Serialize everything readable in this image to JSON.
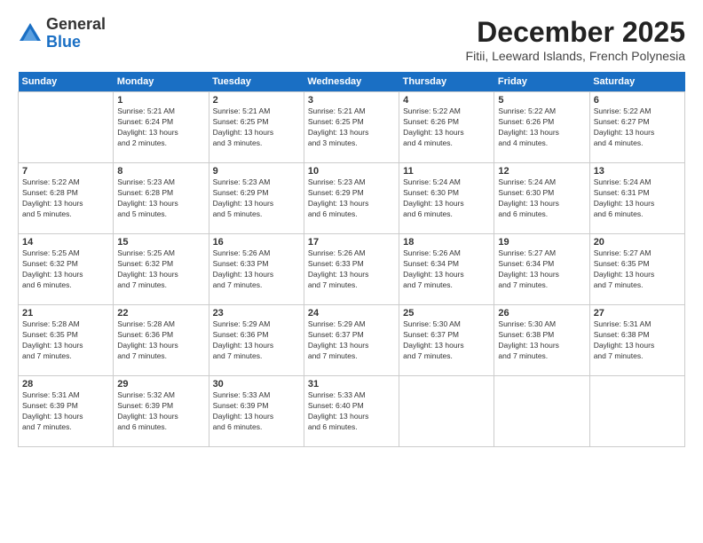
{
  "logo": {
    "general": "General",
    "blue": "Blue"
  },
  "title": "December 2025",
  "location": "Fitii, Leeward Islands, French Polynesia",
  "days_header": [
    "Sunday",
    "Monday",
    "Tuesday",
    "Wednesday",
    "Thursday",
    "Friday",
    "Saturday"
  ],
  "weeks": [
    [
      {
        "day": "",
        "text": ""
      },
      {
        "day": "1",
        "text": "Sunrise: 5:21 AM\nSunset: 6:24 PM\nDaylight: 13 hours\nand 2 minutes."
      },
      {
        "day": "2",
        "text": "Sunrise: 5:21 AM\nSunset: 6:25 PM\nDaylight: 13 hours\nand 3 minutes."
      },
      {
        "day": "3",
        "text": "Sunrise: 5:21 AM\nSunset: 6:25 PM\nDaylight: 13 hours\nand 3 minutes."
      },
      {
        "day": "4",
        "text": "Sunrise: 5:22 AM\nSunset: 6:26 PM\nDaylight: 13 hours\nand 4 minutes."
      },
      {
        "day": "5",
        "text": "Sunrise: 5:22 AM\nSunset: 6:26 PM\nDaylight: 13 hours\nand 4 minutes."
      },
      {
        "day": "6",
        "text": "Sunrise: 5:22 AM\nSunset: 6:27 PM\nDaylight: 13 hours\nand 4 minutes."
      }
    ],
    [
      {
        "day": "7",
        "text": "Sunrise: 5:22 AM\nSunset: 6:28 PM\nDaylight: 13 hours\nand 5 minutes."
      },
      {
        "day": "8",
        "text": "Sunrise: 5:23 AM\nSunset: 6:28 PM\nDaylight: 13 hours\nand 5 minutes."
      },
      {
        "day": "9",
        "text": "Sunrise: 5:23 AM\nSunset: 6:29 PM\nDaylight: 13 hours\nand 5 minutes."
      },
      {
        "day": "10",
        "text": "Sunrise: 5:23 AM\nSunset: 6:29 PM\nDaylight: 13 hours\nand 6 minutes."
      },
      {
        "day": "11",
        "text": "Sunrise: 5:24 AM\nSunset: 6:30 PM\nDaylight: 13 hours\nand 6 minutes."
      },
      {
        "day": "12",
        "text": "Sunrise: 5:24 AM\nSunset: 6:30 PM\nDaylight: 13 hours\nand 6 minutes."
      },
      {
        "day": "13",
        "text": "Sunrise: 5:24 AM\nSunset: 6:31 PM\nDaylight: 13 hours\nand 6 minutes."
      }
    ],
    [
      {
        "day": "14",
        "text": "Sunrise: 5:25 AM\nSunset: 6:32 PM\nDaylight: 13 hours\nand 6 minutes."
      },
      {
        "day": "15",
        "text": "Sunrise: 5:25 AM\nSunset: 6:32 PM\nDaylight: 13 hours\nand 7 minutes."
      },
      {
        "day": "16",
        "text": "Sunrise: 5:26 AM\nSunset: 6:33 PM\nDaylight: 13 hours\nand 7 minutes."
      },
      {
        "day": "17",
        "text": "Sunrise: 5:26 AM\nSunset: 6:33 PM\nDaylight: 13 hours\nand 7 minutes."
      },
      {
        "day": "18",
        "text": "Sunrise: 5:26 AM\nSunset: 6:34 PM\nDaylight: 13 hours\nand 7 minutes."
      },
      {
        "day": "19",
        "text": "Sunrise: 5:27 AM\nSunset: 6:34 PM\nDaylight: 13 hours\nand 7 minutes."
      },
      {
        "day": "20",
        "text": "Sunrise: 5:27 AM\nSunset: 6:35 PM\nDaylight: 13 hours\nand 7 minutes."
      }
    ],
    [
      {
        "day": "21",
        "text": "Sunrise: 5:28 AM\nSunset: 6:35 PM\nDaylight: 13 hours\nand 7 minutes."
      },
      {
        "day": "22",
        "text": "Sunrise: 5:28 AM\nSunset: 6:36 PM\nDaylight: 13 hours\nand 7 minutes."
      },
      {
        "day": "23",
        "text": "Sunrise: 5:29 AM\nSunset: 6:36 PM\nDaylight: 13 hours\nand 7 minutes."
      },
      {
        "day": "24",
        "text": "Sunrise: 5:29 AM\nSunset: 6:37 PM\nDaylight: 13 hours\nand 7 minutes."
      },
      {
        "day": "25",
        "text": "Sunrise: 5:30 AM\nSunset: 6:37 PM\nDaylight: 13 hours\nand 7 minutes."
      },
      {
        "day": "26",
        "text": "Sunrise: 5:30 AM\nSunset: 6:38 PM\nDaylight: 13 hours\nand 7 minutes."
      },
      {
        "day": "27",
        "text": "Sunrise: 5:31 AM\nSunset: 6:38 PM\nDaylight: 13 hours\nand 7 minutes."
      }
    ],
    [
      {
        "day": "28",
        "text": "Sunrise: 5:31 AM\nSunset: 6:39 PM\nDaylight: 13 hours\nand 7 minutes."
      },
      {
        "day": "29",
        "text": "Sunrise: 5:32 AM\nSunset: 6:39 PM\nDaylight: 13 hours\nand 6 minutes."
      },
      {
        "day": "30",
        "text": "Sunrise: 5:33 AM\nSunset: 6:39 PM\nDaylight: 13 hours\nand 6 minutes."
      },
      {
        "day": "31",
        "text": "Sunrise: 5:33 AM\nSunset: 6:40 PM\nDaylight: 13 hours\nand 6 minutes."
      },
      {
        "day": "",
        "text": ""
      },
      {
        "day": "",
        "text": ""
      },
      {
        "day": "",
        "text": ""
      }
    ]
  ]
}
